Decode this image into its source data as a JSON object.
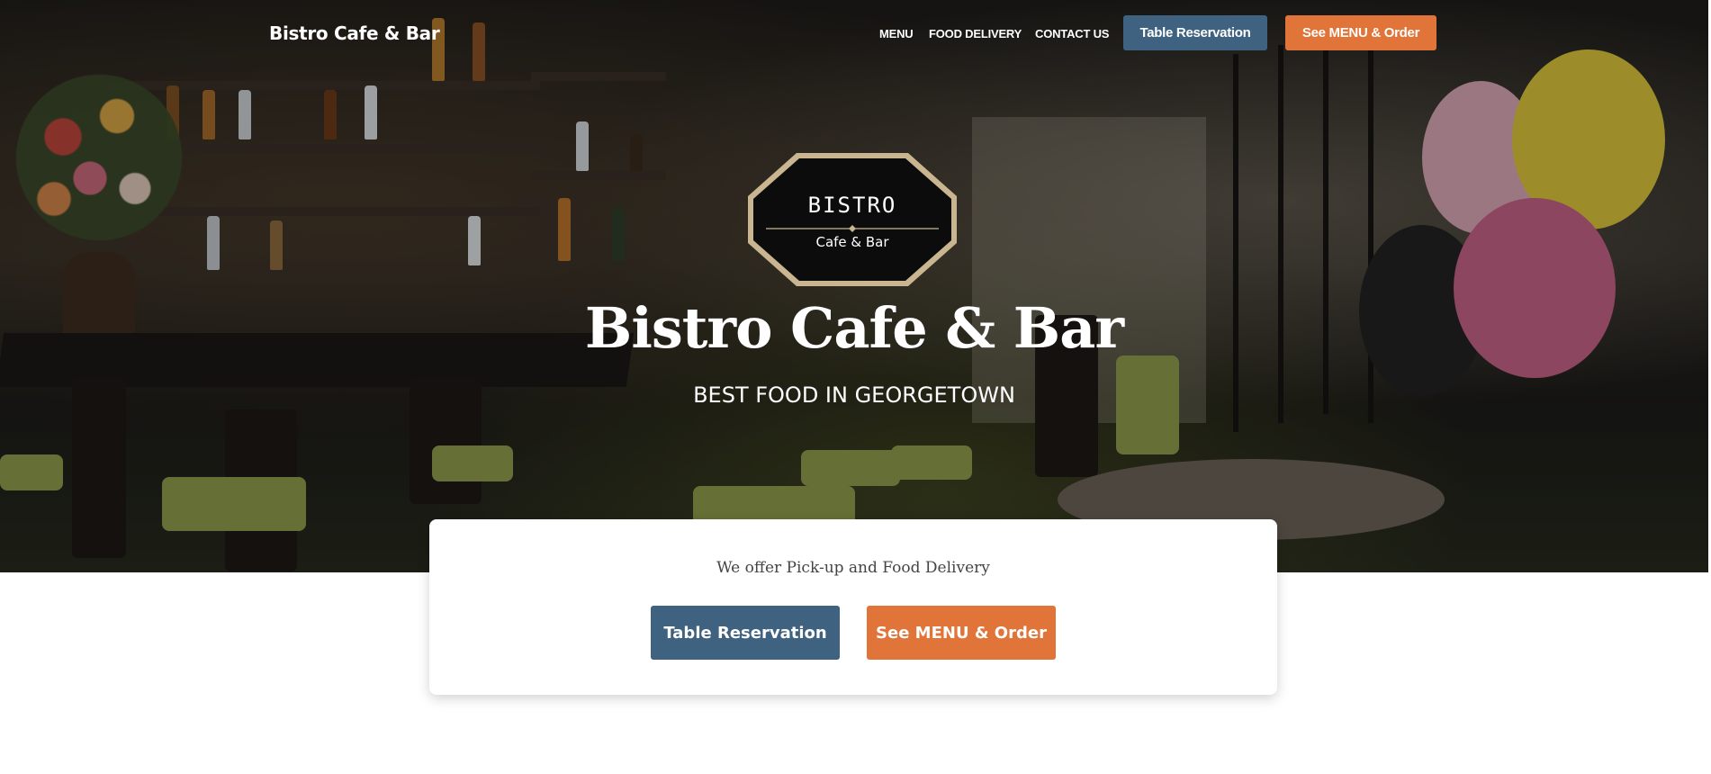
{
  "nav": {
    "brand": "Bistro Cafe & Bar",
    "links": [
      "MENU",
      "FOOD DELIVERY",
      "CONTACT US"
    ],
    "reservation_label": "Table Reservation",
    "order_label": "See MENU & Order"
  },
  "logo": {
    "top_text": "BISTRO",
    "bottom_text": "Cafe & Bar"
  },
  "hero": {
    "title": "Bistro Cafe & Bar",
    "subtitle": "BEST FOOD IN GEORGETOWN"
  },
  "card": {
    "text": "We offer Pick-up and Food Delivery",
    "reservation_label": "Table Reservation",
    "order_label": "See MENU & Order"
  },
  "colors": {
    "reservation_button": "#3f6281",
    "order_button": "#e17438",
    "logo_border": "#c9b690"
  }
}
